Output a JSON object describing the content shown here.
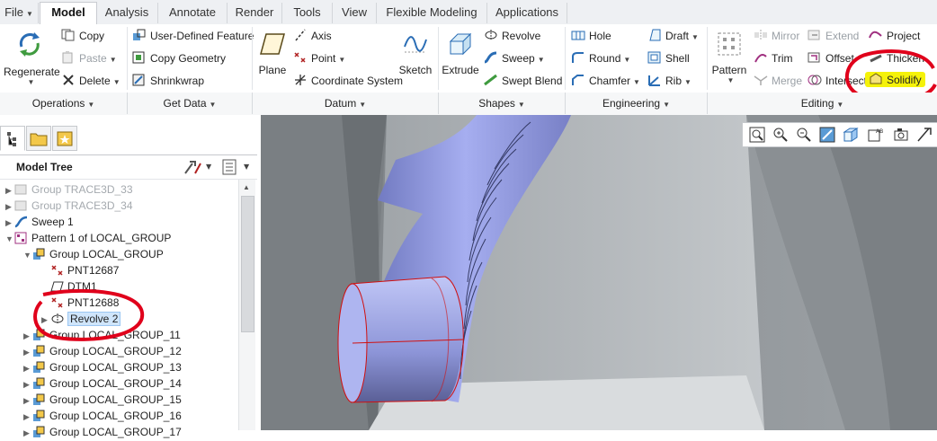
{
  "tabs": {
    "file": "File",
    "model": "Model",
    "analysis": "Analysis",
    "annotate": "Annotate",
    "render": "Render",
    "tools": "Tools",
    "view": "View",
    "flexible_modeling": "Flexible Modeling",
    "applications": "Applications"
  },
  "ribbon": {
    "operations": {
      "regenerate": "Regenerate",
      "copy": "Copy",
      "paste": "Paste",
      "delete": "Delete",
      "group": "Operations"
    },
    "get_data": {
      "user_defined_feature": "User-Defined Feature",
      "copy_geometry": "Copy Geometry",
      "shrinkwrap": "Shrinkwrap",
      "group": "Get Data"
    },
    "datum": {
      "plane": "Plane",
      "axis": "Axis",
      "point": "Point",
      "coordinate_system": "Coordinate System",
      "sketch": "Sketch",
      "group": "Datum"
    },
    "shapes": {
      "extrude": "Extrude",
      "revolve": "Revolve",
      "sweep": "Sweep",
      "swept_blend": "Swept Blend",
      "group": "Shapes"
    },
    "engineering": {
      "hole": "Hole",
      "round": "Round",
      "chamfer": "Chamfer",
      "draft": "Draft",
      "shell": "Shell",
      "rib": "Rib",
      "group": "Engineering"
    },
    "editing": {
      "pattern": "Pattern",
      "mirror": "Mirror",
      "trim": "Trim",
      "merge": "Merge",
      "extend": "Extend",
      "offset": "Offset",
      "intersect": "Intersect",
      "project": "Project",
      "thicken": "Thicken",
      "solidify": "Solidify",
      "group": "Editing"
    }
  },
  "model_tree": {
    "title": "Model Tree",
    "items": [
      {
        "label": "Group TRACE3D_33"
      },
      {
        "label": "Group TRACE3D_34"
      },
      {
        "label": "Sweep 1"
      },
      {
        "label": "Pattern 1 of LOCAL_GROUP"
      },
      {
        "label": "Group LOCAL_GROUP"
      },
      {
        "label": "PNT12687"
      },
      {
        "label": "DTM1"
      },
      {
        "label": "PNT12688"
      },
      {
        "label": "Revolve 2"
      },
      {
        "label": "Group LOCAL_GROUP_11"
      },
      {
        "label": "Group LOCAL_GROUP_12"
      },
      {
        "label": "Group LOCAL_GROUP_13"
      },
      {
        "label": "Group LOCAL_GROUP_14"
      },
      {
        "label": "Group LOCAL_GROUP_15"
      },
      {
        "label": "Group LOCAL_GROUP_16"
      },
      {
        "label": "Group LOCAL_GROUP_17"
      }
    ]
  },
  "colors": {
    "annotation_red": "#e0001b",
    "highlight_yellow": "#f5f20a",
    "selection_blue": "#cfe5fb",
    "surface_blue": "#9aa3e3"
  }
}
